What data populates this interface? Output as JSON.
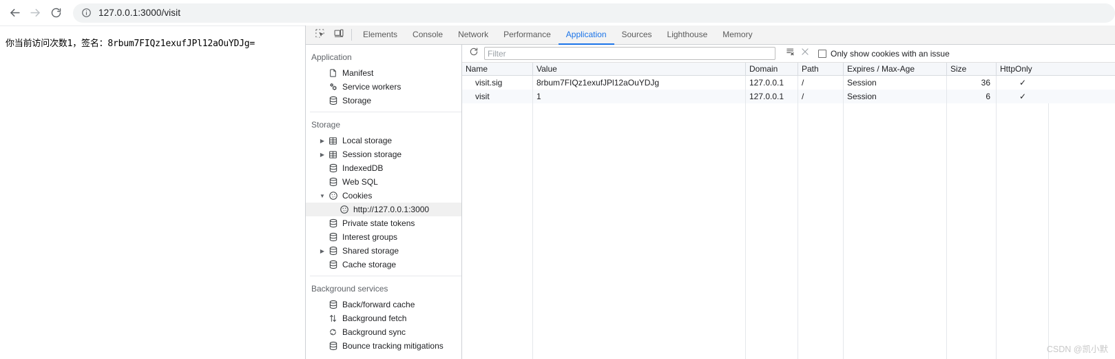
{
  "browser": {
    "back_icon": "arrow-left-icon",
    "forward_icon": "arrow-right-icon",
    "reload_icon": "reload-icon",
    "site_info_icon": "info-circle-icon",
    "url": "127.0.0.1:3000/visit"
  },
  "page": {
    "body_text": "你当前访问次数1，签名：8rbum7FIQz1exufJPl12aOuYDJg="
  },
  "devtools": {
    "tool_icons": [
      {
        "name": "inspect-element-icon",
        "title": "Inspect"
      },
      {
        "name": "device-toolbar-icon",
        "title": "Toggle device toolbar"
      }
    ],
    "tabs": [
      {
        "label": "Elements",
        "active": false
      },
      {
        "label": "Console",
        "active": false
      },
      {
        "label": "Network",
        "active": false
      },
      {
        "label": "Performance",
        "active": false
      },
      {
        "label": "Application",
        "active": true
      },
      {
        "label": "Sources",
        "active": false
      },
      {
        "label": "Lighthouse",
        "active": false
      },
      {
        "label": "Memory",
        "active": false
      }
    ],
    "active_tab_color": "#1a73e8",
    "sidebar": {
      "sections": [
        {
          "title": "Application",
          "items": [
            {
              "label": "Manifest",
              "icon": "document-icon",
              "arrow": "none",
              "depth": 1,
              "selected": false
            },
            {
              "label": "Service workers",
              "icon": "gears-icon",
              "arrow": "none",
              "depth": 1,
              "selected": false
            },
            {
              "label": "Storage",
              "icon": "database-icon",
              "arrow": "none",
              "depth": 1,
              "selected": false
            }
          ]
        },
        {
          "title": "Storage",
          "items": [
            {
              "label": "Local storage",
              "icon": "table-icon",
              "arrow": "collapsed",
              "depth": 1,
              "selected": false
            },
            {
              "label": "Session storage",
              "icon": "table-icon",
              "arrow": "collapsed",
              "depth": 1,
              "selected": false
            },
            {
              "label": "IndexedDB",
              "icon": "database-icon",
              "arrow": "none",
              "depth": 1,
              "selected": false
            },
            {
              "label": "Web SQL",
              "icon": "database-icon",
              "arrow": "none",
              "depth": 1,
              "selected": false
            },
            {
              "label": "Cookies",
              "icon": "cookie-icon",
              "arrow": "expanded",
              "depth": 1,
              "selected": false
            },
            {
              "label": "http://127.0.0.1:3000",
              "icon": "cookie-icon",
              "arrow": "none",
              "depth": 2,
              "selected": true
            },
            {
              "label": "Private state tokens",
              "icon": "database-icon",
              "arrow": "none",
              "depth": 1,
              "selected": false
            },
            {
              "label": "Interest groups",
              "icon": "database-icon",
              "arrow": "none",
              "depth": 1,
              "selected": false
            },
            {
              "label": "Shared storage",
              "icon": "database-icon",
              "arrow": "collapsed",
              "depth": 1,
              "selected": false
            },
            {
              "label": "Cache storage",
              "icon": "database-icon",
              "arrow": "none",
              "depth": 1,
              "selected": false
            }
          ]
        },
        {
          "title": "Background services",
          "items": [
            {
              "label": "Back/forward cache",
              "icon": "database-icon",
              "arrow": "none",
              "depth": 1,
              "selected": false
            },
            {
              "label": "Background fetch",
              "icon": "arrows-updown-icon",
              "arrow": "none",
              "depth": 1,
              "selected": false
            },
            {
              "label": "Background sync",
              "icon": "sync-icon",
              "arrow": "none",
              "depth": 1,
              "selected": false
            },
            {
              "label": "Bounce tracking mitigations",
              "icon": "database-icon",
              "arrow": "none",
              "depth": 1,
              "selected": false
            }
          ]
        }
      ]
    },
    "cookie_toolbar": {
      "refresh_icon": "refresh-icon",
      "filter_value": "",
      "filter_placeholder": "Filter",
      "clear_all_icon": "clear-all-cookies-icon",
      "delete_icon": "delete-cookie-icon",
      "only_issues_checked": false,
      "only_issues_label": "Only show cookies with an issue"
    },
    "cookie_table": {
      "columns": [
        "Name",
        "Value",
        "Domain",
        "Path",
        "Expires / Max-Age",
        "Size",
        "HttpOnly"
      ],
      "rows": [
        {
          "name": "visit.sig",
          "value": "8rbum7FIQz1exufJPl12aOuYDJg",
          "domain": "127.0.0.1",
          "path": "/",
          "expires": "Session",
          "size": "36",
          "httponly": "✓"
        },
        {
          "name": "visit",
          "value": "1",
          "domain": "127.0.0.1",
          "path": "/",
          "expires": "Session",
          "size": "6",
          "httponly": "✓"
        }
      ]
    }
  },
  "watermark": "CSDN @凯小默"
}
